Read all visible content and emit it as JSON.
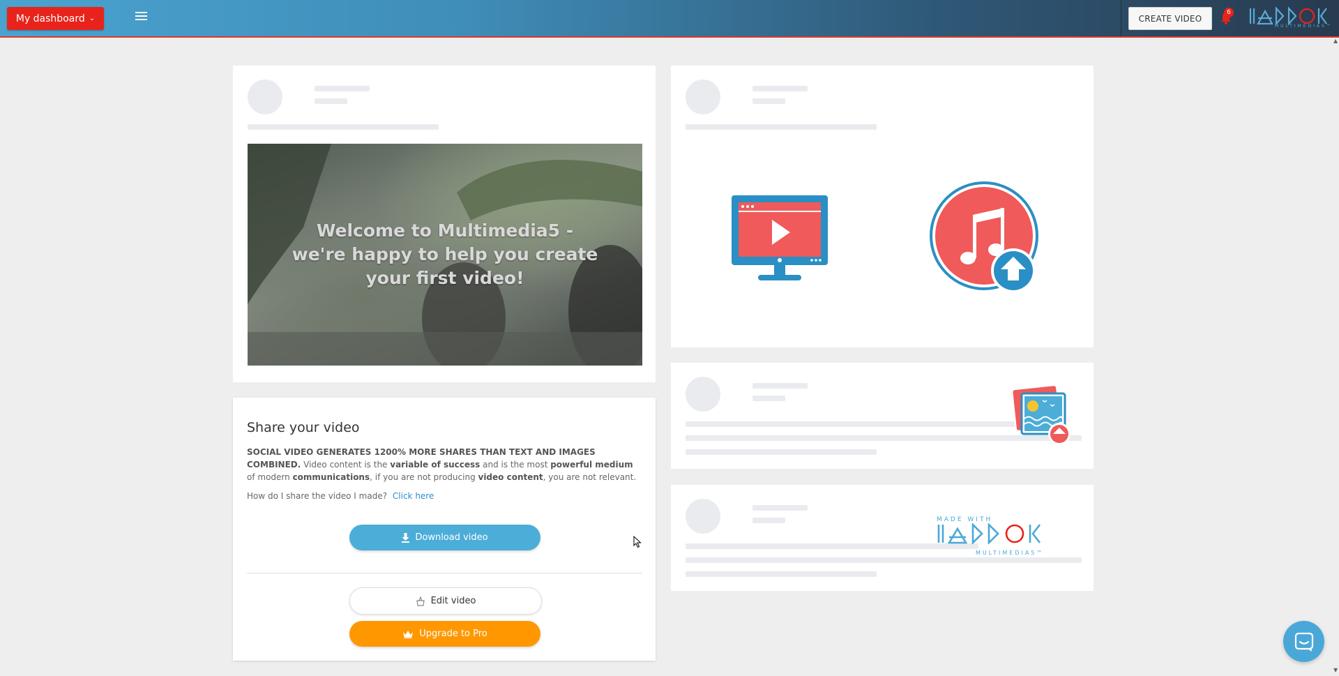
{
  "topbar": {
    "dashboard_label": "My dashboard",
    "create_video_label": "CREATE VIDEO",
    "notification_count": "6",
    "logo_sub": "MULTIMEDIA5™"
  },
  "welcome": {
    "text": "Welcome to Multimedia5 - we're happy to help you create your first video!"
  },
  "share": {
    "title": "Share your video",
    "lead": "SOCIAL VIDEO GENERATES 1200% MORE SHARES THAN TEXT AND IMAGES COMBINED.",
    "t1": " Video content is the ",
    "b1": "variable of success",
    "t2": " and is the most ",
    "b2": "powerful medium",
    "t3": " of modern ",
    "b3": "communications",
    "t4": ", if you are not producing ",
    "b4": "video content",
    "t5": ", you are not relevant.",
    "question": "How do I share the video I made?",
    "link": "Click here",
    "download_label": "Download video",
    "edit_label": "Edit video",
    "upgrade_label": "Upgrade to Pro"
  },
  "made_with": {
    "top": "MADE WITH",
    "bottom": "MULTIMEDIA5™"
  },
  "colors": {
    "accent_red": "#e8231b",
    "accent_blue": "#4badd8",
    "accent_orange": "#ff9800"
  },
  "icons": [
    "menu-icon",
    "bell-icon",
    "video-monitor-icon",
    "music-upload-icon",
    "image-upload-icon",
    "download-icon",
    "basket-icon",
    "crown-icon",
    "chat-icon"
  ]
}
